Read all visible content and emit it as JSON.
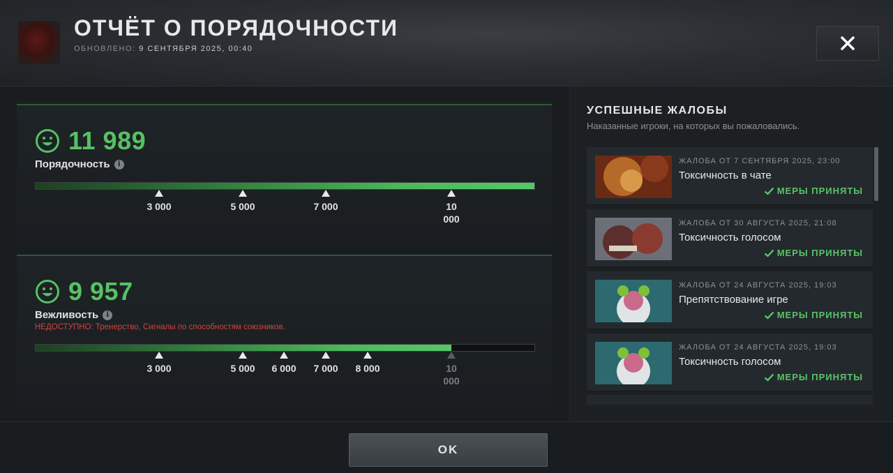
{
  "header": {
    "title": "ОТЧЁТ О ПОРЯДОЧНОСТИ",
    "updated_label": "ОБНОВЛЕНО:",
    "updated_value": "9 СЕНТЯБРЯ 2025, 00:40",
    "close_icon": "close-icon"
  },
  "conduct": {
    "score": "11 989",
    "label": "Порядочность",
    "progress_fraction": 1.0,
    "ticks": [
      "3 000",
      "5 000",
      "7 000",
      "10 000"
    ]
  },
  "behavior": {
    "score": "9 957",
    "label": "Вежливость",
    "warning": "НЕДОСТУПНО:  Тренерство, Сигналы по способностям союзников.",
    "progress_fraction": 0.833,
    "ticks": [
      "3 000",
      "5 000",
      "6 000",
      "7 000",
      "8 000",
      "10 000"
    ]
  },
  "reports": {
    "title": "УСПЕШНЫЕ ЖАЛОБЫ",
    "subtitle": "Наказанные игроки, на которых вы пожаловались.",
    "items": [
      {
        "date": "ЖАЛОБА ОТ 7 СЕНТЯБРЯ 2025, 23:00",
        "reason": "Токсичность в чате",
        "status": "МЕРЫ ПРИНЯТЫ",
        "hero": "lion-hero"
      },
      {
        "date": "ЖАЛОБА ОТ 30 АВГУСТА 2025, 21:08",
        "reason": "Токсичность голосом",
        "status": "МЕРЫ ПРИНЯТЫ",
        "hero": "beast-hero"
      },
      {
        "date": "ЖАЛОБА ОТ 24 АВГУСТА 2025, 19:03",
        "reason": "Препятствование игре",
        "status": "МЕРЫ ПРИНЯТЫ",
        "hero": "sniper-hero"
      },
      {
        "date": "ЖАЛОБА ОТ 24 АВГУСТА 2025, 19:03",
        "reason": "Токсичность голосом",
        "status": "МЕРЫ ПРИНЯТЫ",
        "hero": "sniper-hero"
      }
    ]
  },
  "footer": {
    "ok_label": "OK"
  },
  "colors": {
    "accent_green": "#57c164",
    "warning_red": "#d2433a"
  }
}
